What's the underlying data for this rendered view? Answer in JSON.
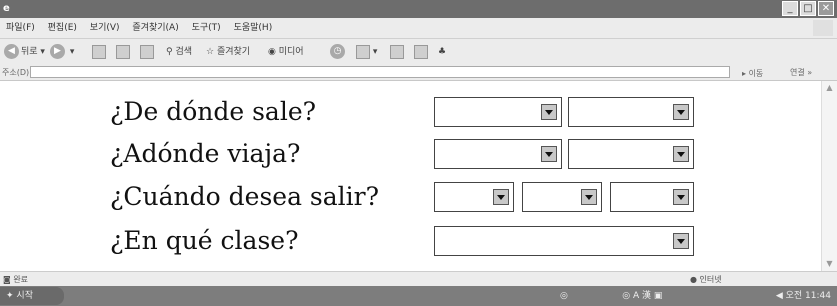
{
  "window": {
    "title_icon": "ie-icon"
  },
  "menu": [
    "파일(F)",
    "편집(E)",
    "보기(V)",
    "즐겨찾기(A)",
    "도구(T)",
    "도움말(H)"
  ],
  "toolbar": {
    "back": "뒤로",
    "search": "검색",
    "favorites": "즐겨찾기",
    "media": "미디어"
  },
  "address": {
    "label": "주소(D)",
    "go": "이동",
    "links": "연결 »"
  },
  "form": {
    "q1": "¿De dónde sale?",
    "q2": "¿Adónde viaja?",
    "q3": "¿Cuándo desea salir?",
    "q4": "¿En qué clase?"
  },
  "status": {
    "left": "완료",
    "zone": "인터넷"
  },
  "taskbar": {
    "start": "시작",
    "tray_text": "A 漢",
    "clock": "오전 11:44"
  }
}
